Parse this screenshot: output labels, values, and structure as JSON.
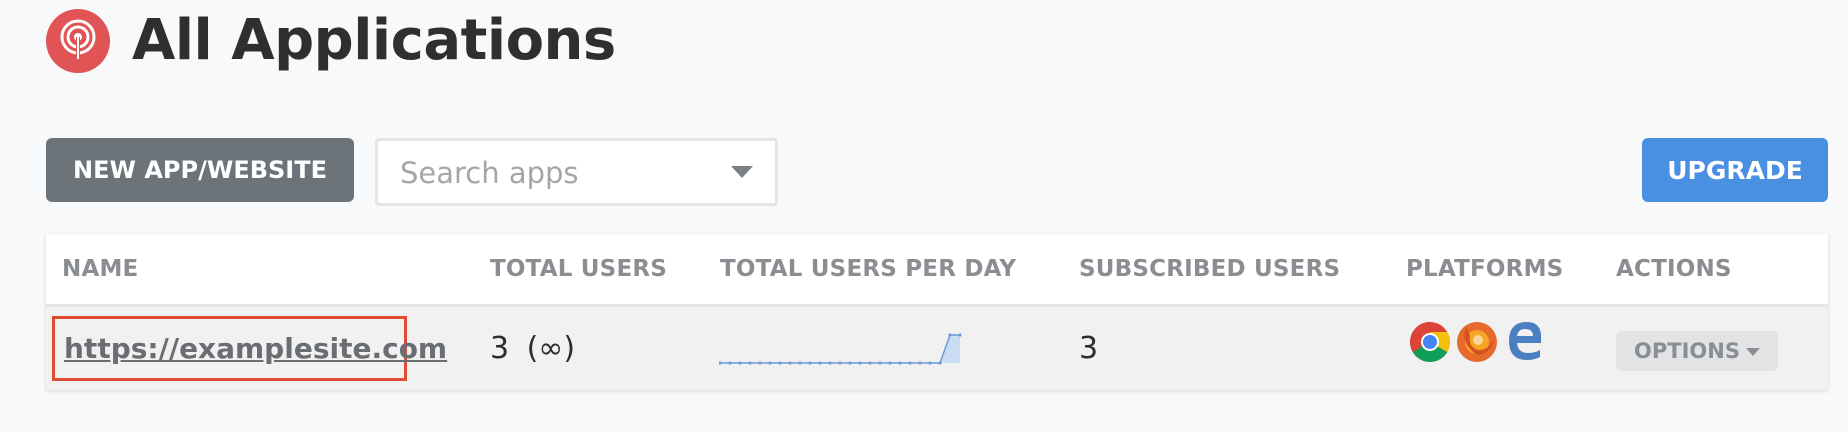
{
  "page": {
    "title": "All Applications",
    "logo_icon": "app-signal-logo-icon",
    "accent_color": "#e05455"
  },
  "toolbar": {
    "new_app_label": "NEW APP/WEBSITE",
    "search_placeholder": "Search apps",
    "upgrade_label": "UPGRADE",
    "upgrade_color": "#4a90e2"
  },
  "table": {
    "headers": [
      "NAME",
      "TOTAL USERS",
      "TOTAL USERS PER DAY",
      "SUBSCRIBED USERS",
      "PLATFORMS",
      "ACTIONS"
    ],
    "rows": [
      {
        "name": "https://examplesite.com",
        "total_users": "3",
        "total_users_cap": "(∞)",
        "users_per_day": [
          0,
          0,
          0,
          0,
          0,
          0,
          0,
          0,
          0,
          0,
          0,
          0,
          0,
          0,
          0,
          0,
          0,
          0,
          0,
          0,
          0,
          0,
          0,
          3,
          3
        ],
        "subscribed_users": "3",
        "platforms": [
          "chrome-icon",
          "firefox-icon",
          "edge-icon"
        ],
        "actions_label": "OPTIONS"
      }
    ]
  }
}
